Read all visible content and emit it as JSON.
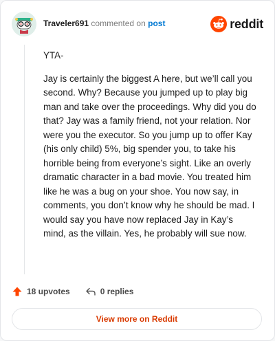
{
  "header": {
    "username": "Traveler691",
    "action_text": "commented on",
    "post_link": "post",
    "logo_text": "reddit"
  },
  "comment": {
    "paragraphs": [
      "YTA-",
      "Jay is certainly the biggest A here, but we’ll call you second. Why? Because you jumped up to play big man and take over the proceedings. Why did you do that? Jay was a family friend, not your relation. Nor were you the executor. So you jump up to offer Kay (his only child) 5%, big spender you, to take his horrible being from everyone’s sight. Like an overly dramatic character in a bad movie. You treated him like he was a bug on your shoe. You now say, in comments, you don’t know why he should be mad. I would say you have now replaced Jay in Kay’s mind, as the villain. Yes, he probably will sue now."
    ]
  },
  "actions": {
    "upvotes": "18 upvotes",
    "replies": "0 replies"
  },
  "footer": {
    "view_more": "View more on Reddit"
  },
  "colors": {
    "brand": "#ff4500",
    "upvote": "#ff4500",
    "link": "#0079d3",
    "view_more": "#d93a00"
  },
  "icons": [
    "avatar-snoo",
    "reddit-logo-icon",
    "upvote-icon",
    "reply-icon"
  ]
}
